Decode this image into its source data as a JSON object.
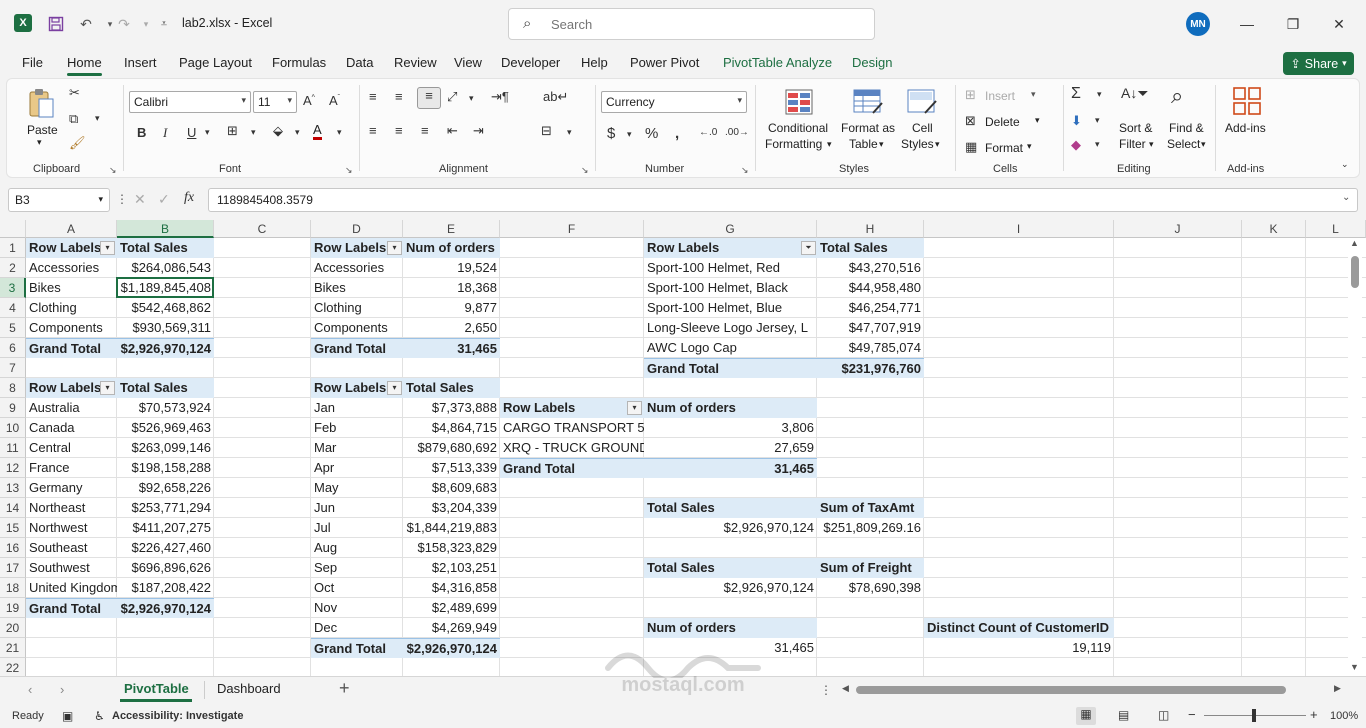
{
  "window": {
    "doc_title": "lab2.xlsx  -  Excel",
    "search_placeholder": "Search",
    "avatar_initials": "MN"
  },
  "tabs": [
    "File",
    "Home",
    "Insert",
    "Page Layout",
    "Formulas",
    "Data",
    "Review",
    "View",
    "Developer",
    "Help",
    "Power Pivot",
    "PivotTable Analyze",
    "Design"
  ],
  "share_label": "Share",
  "ribbon": {
    "clipboard": {
      "paste": "Paste",
      "label": "Clipboard"
    },
    "font": {
      "name": "Calibri",
      "size": "11",
      "label": "Font",
      "bold": "B",
      "italic": "I",
      "underline": "U"
    },
    "alignment": {
      "label": "Alignment"
    },
    "number": {
      "format": "Currency",
      "label": "Number"
    },
    "styles": {
      "conditional": "Conditional",
      "conditional2": "Formatting",
      "format_as": "Format as",
      "format_as2": "Table",
      "cell": "Cell",
      "cell2": "Styles",
      "label": "Styles"
    },
    "cells": {
      "insert": "Insert",
      "delete": "Delete",
      "format": "Format",
      "label": "Cells"
    },
    "editing": {
      "sort": "Sort &",
      "sort2": "Filter",
      "find": "Find &",
      "find2": "Select",
      "label": "Editing"
    },
    "addins": {
      "btn": "Add-ins",
      "label": "Add-ins"
    }
  },
  "formula_bar": {
    "name_box": "B3",
    "formula": "1189845408.3579"
  },
  "columns": [
    "A",
    "B",
    "C",
    "D",
    "E",
    "F",
    "G",
    "H",
    "I",
    "J",
    "K",
    "L"
  ],
  "rows": [
    "1",
    "2",
    "3",
    "4",
    "5",
    "6",
    "7",
    "8",
    "9",
    "10",
    "11",
    "12",
    "13",
    "14",
    "15",
    "16",
    "17",
    "18",
    "19",
    "20",
    "21",
    "22"
  ],
  "pivot1": {
    "h1": "Row Labels",
    "h2": "Total Sales",
    "rows": [
      [
        "Accessories",
        "$264,086,543"
      ],
      [
        "Bikes",
        "$1,189,845,408"
      ],
      [
        "Clothing",
        "$542,468,862"
      ],
      [
        "Components",
        "$930,569,311"
      ]
    ],
    "total": [
      "Grand Total",
      "$2,926,970,124"
    ]
  },
  "pivot2": {
    "h1": "Row Labels",
    "h2": "Total Sales",
    "rows": [
      [
        "Australia",
        "$70,573,924"
      ],
      [
        "Canada",
        "$526,969,463"
      ],
      [
        "Central",
        "$263,099,146"
      ],
      [
        "France",
        "$198,158,288"
      ],
      [
        "Germany",
        "$92,658,226"
      ],
      [
        "Northeast",
        "$253,771,294"
      ],
      [
        "Northwest",
        "$411,207,275"
      ],
      [
        "Southeast",
        "$226,427,460"
      ],
      [
        "Southwest",
        "$696,896,626"
      ],
      [
        "United Kingdom",
        "$187,208,422"
      ]
    ],
    "total": [
      "Grand Total",
      "$2,926,970,124"
    ]
  },
  "pivot3": {
    "h1": "Row Labels",
    "h2": "Num of orders",
    "rows": [
      [
        "Accessories",
        "19,524"
      ],
      [
        "Bikes",
        "18,368"
      ],
      [
        "Clothing",
        "9,877"
      ],
      [
        "Components",
        "2,650"
      ]
    ],
    "total": [
      "Grand Total",
      "31,465"
    ]
  },
  "pivot4": {
    "h1": "Row Labels",
    "h2": "Total Sales",
    "rows": [
      [
        "Jan",
        "$7,373,888"
      ],
      [
        "Feb",
        "$4,864,715"
      ],
      [
        "Mar",
        "$879,680,692"
      ],
      [
        "Apr",
        "$7,513,339"
      ],
      [
        "May",
        "$8,609,683"
      ],
      [
        "Jun",
        "$3,204,339"
      ],
      [
        "Jul",
        "$1,844,219,883"
      ],
      [
        "Aug",
        "$158,323,829"
      ],
      [
        "Sep",
        "$2,103,251"
      ],
      [
        "Oct",
        "$4,316,858"
      ],
      [
        "Nov",
        "$2,489,699"
      ],
      [
        "Dec",
        "$4,269,949"
      ]
    ],
    "total": [
      "Grand Total",
      "$2,926,970,124"
    ]
  },
  "pivot5": {
    "h1": "Row Labels",
    "h2": "Num of orders",
    "rows": [
      [
        "CARGO TRANSPORT 5",
        "3,806"
      ],
      [
        "XRQ - TRUCK GROUND",
        "27,659"
      ]
    ],
    "total": [
      "Grand Total",
      "31,465"
    ]
  },
  "pivot6": {
    "h1": "Row Labels",
    "h2": "Total Sales",
    "rows": [
      [
        "Sport-100 Helmet, Red",
        "$43,270,516"
      ],
      [
        "Sport-100 Helmet, Black",
        "$44,958,480"
      ],
      [
        "Sport-100 Helmet, Blue",
        "$46,254,771"
      ],
      [
        "Long-Sleeve Logo Jersey, L",
        "$47,707,919"
      ],
      [
        "AWC Logo Cap",
        "$49,785,074"
      ]
    ],
    "total": [
      "Grand Total",
      "$231,976,760"
    ]
  },
  "kpi1": {
    "h1": "Total Sales",
    "h2": "Sum of TaxAmt",
    "v1": "$2,926,970,124",
    "v2": "$251,809,269.16"
  },
  "kpi2": {
    "h1": "Total Sales",
    "h2": "Sum of Freight",
    "v1": "$2,926,970,124",
    "v2": "$78,690,398"
  },
  "kpi3": {
    "h1": "Num of orders",
    "v1": "31,465"
  },
  "kpi4": {
    "h1": "Distinct Count of CustomerID",
    "v1": "19,119"
  },
  "sheets": [
    "PivotTable",
    "Dashboard"
  ],
  "status": {
    "ready": "Ready",
    "accessibility": "Accessibility: Investigate",
    "zoom": "100%"
  },
  "watermark": {
    "latin": "mostaql.com"
  }
}
